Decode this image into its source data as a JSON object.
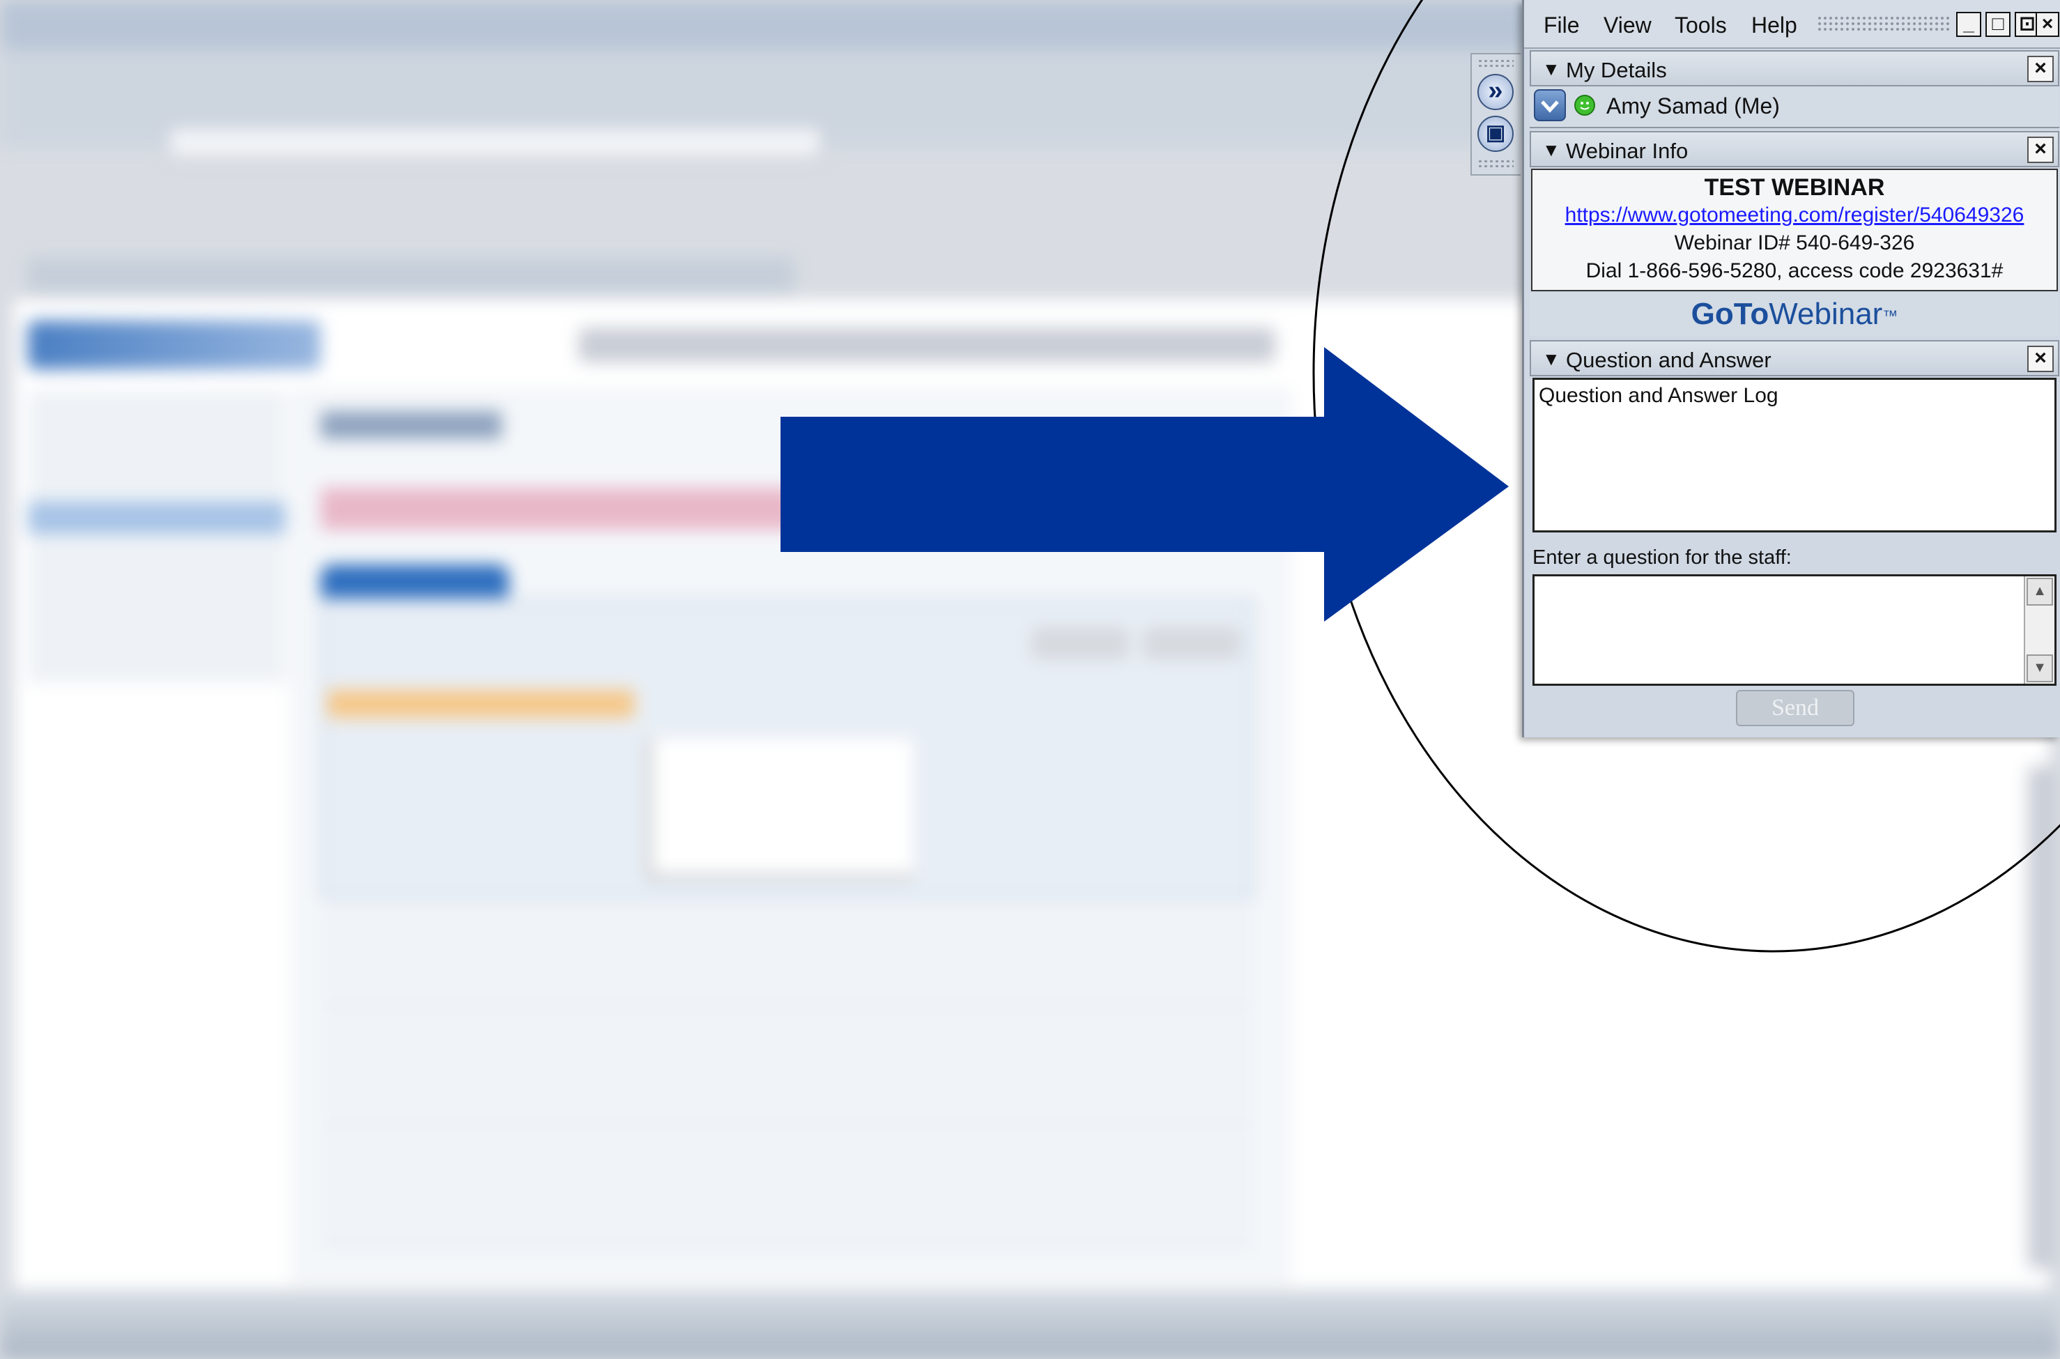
{
  "panel": {
    "menu": [
      "File",
      "View",
      "Tools",
      "Help"
    ],
    "window_buttons": [
      "_",
      "□",
      "⊡",
      "×"
    ],
    "my_details": {
      "title": "My Details",
      "user": "Amy Samad (Me)"
    },
    "webinar_info": {
      "title": "Webinar Info",
      "name": "TEST WEBINAR",
      "link": "https://www.gotomeeting.com/register/540649326",
      "webinar_id": "Webinar ID# 540-649-326",
      "dial": "Dial 1-866-596-5280, access code 2923631#",
      "logo_goto": "GoTo",
      "logo_webinar": "Webinar",
      "logo_tm": "™"
    },
    "qa": {
      "title": "Question and Answer",
      "log_text": "Question and Answer Log",
      "prompt": "Enter a question for the staff:",
      "input_value": "",
      "send_label": "Send"
    },
    "close_glyph": "×",
    "collapse_glyph": "▼"
  },
  "dock": {
    "forward_glyph": "»",
    "screen_glyph": "▣"
  },
  "colors": {
    "arrow": "#003399",
    "link": "#1a1aff",
    "logo_blue": "#1b4f9c",
    "panel_bg": "#cfd8e3"
  }
}
